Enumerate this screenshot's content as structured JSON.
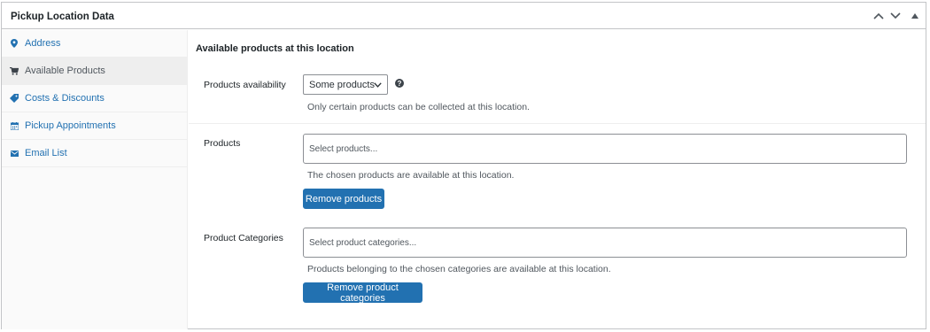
{
  "metabox": {
    "title": "Pickup Location Data"
  },
  "tabs": [
    {
      "label": "Address",
      "icon": "map-pin-icon"
    },
    {
      "label": "Available Products",
      "icon": "cart-icon"
    },
    {
      "label": "Costs & Discounts",
      "icon": "tag-icon"
    },
    {
      "label": "Pickup Appointments",
      "icon": "calendar-icon"
    },
    {
      "label": "Email List",
      "icon": "mail-icon"
    }
  ],
  "active_tab": "Available Products",
  "panel": {
    "heading": "Available products at this location",
    "availability": {
      "label": "Products availability",
      "selected": "Some products",
      "description": "Only certain products can be collected at this location."
    },
    "products": {
      "label": "Products",
      "placeholder": "Select products...",
      "description": "The chosen products are available at this location.",
      "button": "Remove products"
    },
    "categories": {
      "label": "Product Categories",
      "placeholder": "Select product categories...",
      "description": "Products belonging to the chosen categories are available at this location.",
      "button": "Remove product categories"
    }
  },
  "colors": {
    "accent": "#2271b1",
    "border": "#c3c4c7",
    "tab_bg": "#fafafa",
    "active_tab_bg": "#eeeeee"
  }
}
